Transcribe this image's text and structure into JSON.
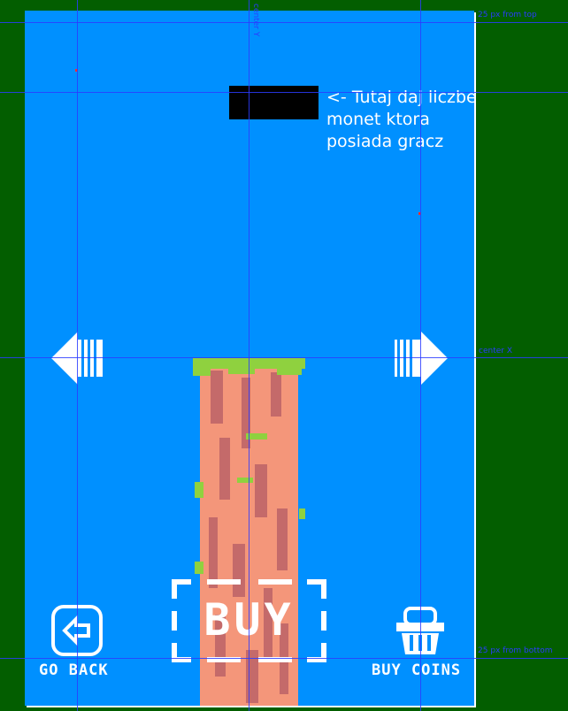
{
  "colors": {
    "outer_background": "#035e00",
    "screen_background": "#0090ff",
    "guide": "#2b3cff",
    "pillar_rock": "#f4967a",
    "pillar_shadow": "#c46a6a",
    "pillar_grass": "#8fd13f",
    "coin_box": "#000000"
  },
  "guides": {
    "center_y": "center Y",
    "px_from_top": "25 px from top",
    "center_x": "center X",
    "px_from_bottom": "25 px from bottom"
  },
  "coin_display": {
    "note_lines": [
      "<- Tutaj daj liczbe",
      "monet ktora",
      "posiada gracz"
    ]
  },
  "nav": {
    "left_arrow_icon": "arrow-left-icon",
    "right_arrow_icon": "arrow-right-icon"
  },
  "buttons": {
    "go_back": {
      "label": "GO BACK",
      "icon": "back-arrow-icon"
    },
    "buy": {
      "label": "BUY"
    },
    "buy_coins": {
      "label": "BUY COINS",
      "icon": "basket-icon"
    }
  }
}
